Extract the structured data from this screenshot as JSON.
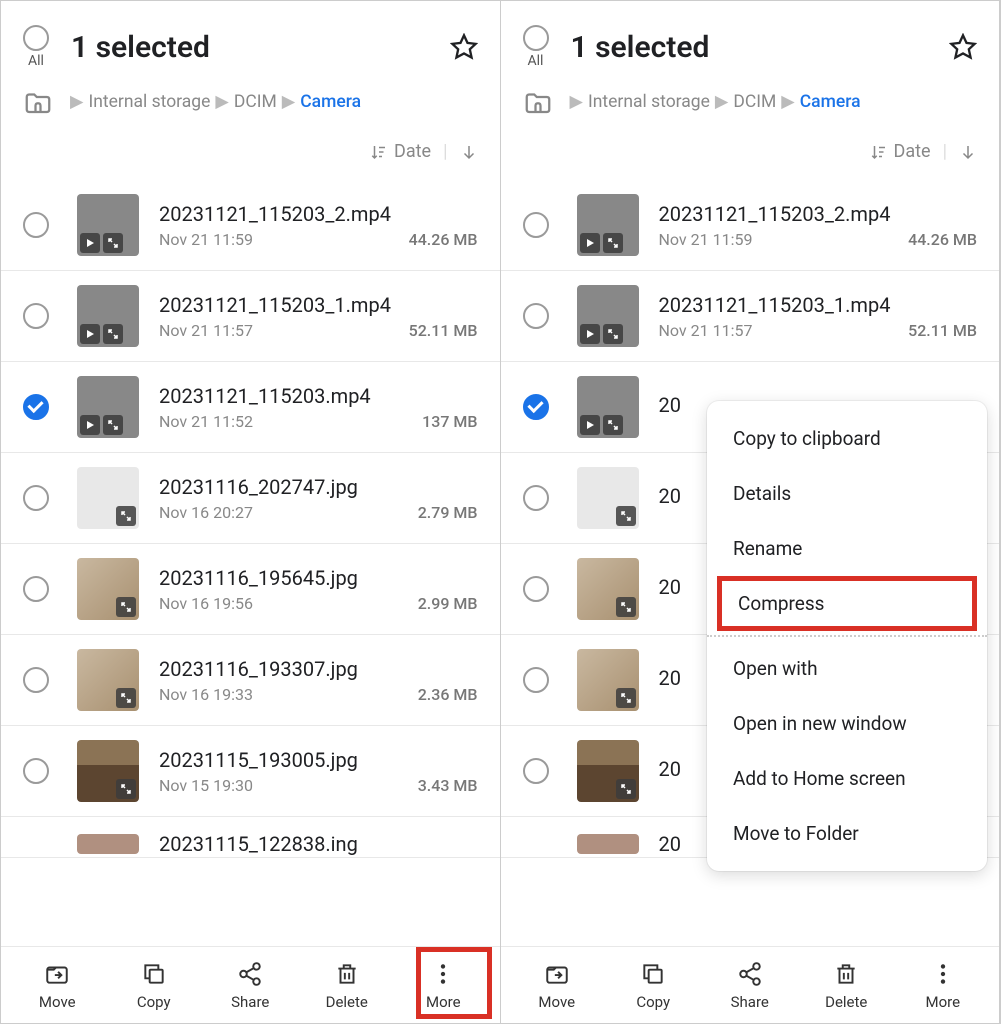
{
  "header": {
    "all_label": "All",
    "title": "1 selected"
  },
  "breadcrumb": {
    "root": "Internal storage",
    "mid": "DCIM",
    "leaf": "Camera"
  },
  "sort": {
    "label": "Date"
  },
  "files": [
    {
      "name": "20231121_115203_2.mp4",
      "date": "Nov 21 11:59",
      "size": "44.26 MB",
      "thumb": "video",
      "selected": false
    },
    {
      "name": "20231121_115203_1.mp4",
      "date": "Nov 21 11:57",
      "size": "52.11 MB",
      "thumb": "video",
      "selected": false
    },
    {
      "name": "20231121_115203.mp4",
      "date": "Nov 21 11:52",
      "size": "137 MB",
      "thumb": "video",
      "selected": true
    },
    {
      "name": "20231116_202747.jpg",
      "date": "Nov 16 20:27",
      "size": "2.79 MB",
      "thumb": "doc",
      "selected": false
    },
    {
      "name": "20231116_195645.jpg",
      "date": "Nov 16 19:56",
      "size": "2.99 MB",
      "thumb": "desk",
      "selected": false
    },
    {
      "name": "20231116_193307.jpg",
      "date": "Nov 16 19:33",
      "size": "2.36 MB",
      "thumb": "desk",
      "selected": false
    },
    {
      "name": "20231115_193005.jpg",
      "date": "Nov 15 19:30",
      "size": "3.43 MB",
      "thumb": "room",
      "selected": false
    }
  ],
  "partial_file": {
    "name": "20231115_122838.ing",
    "name_right_trunc": "20"
  },
  "toolbar": {
    "move": "Move",
    "copy": "Copy",
    "share": "Share",
    "delete": "Delete",
    "more": "More"
  },
  "menu": {
    "copy_clipboard": "Copy to clipboard",
    "details": "Details",
    "rename": "Rename",
    "compress": "Compress",
    "open_with": "Open with",
    "open_new_window": "Open in new window",
    "add_home": "Add to Home screen",
    "move_folder": "Move to Folder"
  }
}
